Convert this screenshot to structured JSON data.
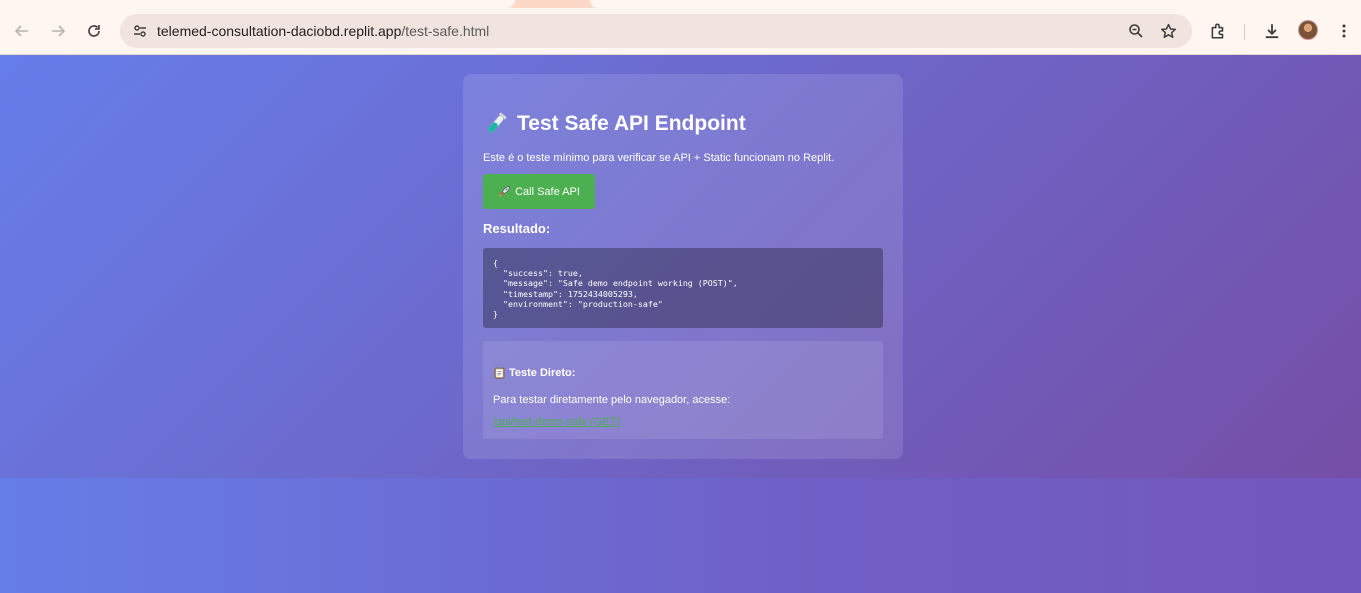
{
  "browser": {
    "url_host": "telemed-consultation-daciobd.replit.app",
    "url_path": "/test-safe.html",
    "icons": {
      "back": "arrow-left-icon",
      "forward": "arrow-right-icon",
      "reload": "reload-icon",
      "site_info": "tune-icon",
      "zoom": "zoom-icon",
      "bookmark": "star-icon",
      "extensions": "puzzle-icon",
      "downloads": "download-icon",
      "menu": "kebab-menu-icon"
    }
  },
  "page": {
    "title_icon": "test-tube-icon",
    "title": "Test Safe API Endpoint",
    "subtitle": "Este é o teste mínimo para verificar se API + Static funcionam no Replit.",
    "call_button_icon": "rocket-icon",
    "call_button_label": "Call Safe API",
    "result_label": "Resultado:",
    "result_json": "{\n  \"success\": true,\n  \"message\": \"Safe demo endpoint working (POST)\",\n  \"timestamp\": 1752434005293,\n  \"environment\": \"production-safe\"\n}",
    "direct_test": {
      "icon": "clipboard-icon",
      "title": "Teste Direto:",
      "text": "Para testar diretamente pelo navegador, acesse:",
      "link_text": "/api/test-demo-safe (GET)"
    }
  },
  "colors": {
    "gradient_start": "#667eea",
    "gradient_end": "#764ba2",
    "button_green": "#4caf50"
  }
}
